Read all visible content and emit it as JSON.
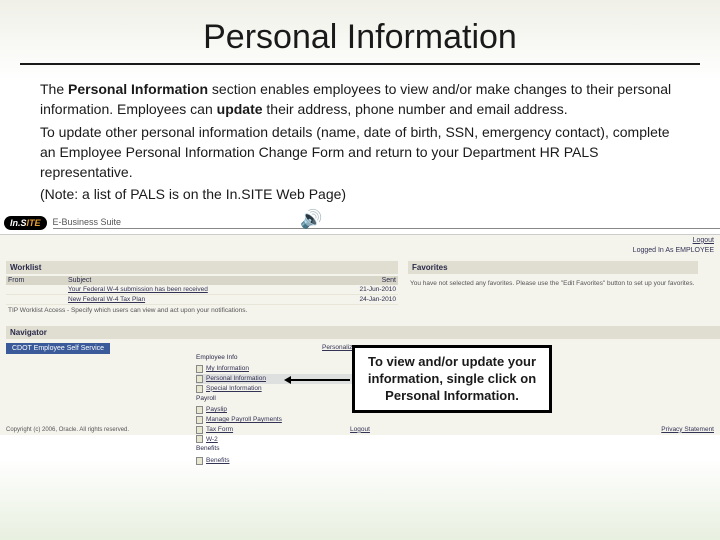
{
  "title": "Personal Information",
  "body": {
    "p1_pre": "The ",
    "p1_bold": "Personal Information",
    "p1_mid": " section enables employees to view and/or make changes to their personal  information. Employees can ",
    "p1_bold2": "update",
    "p1_post": " their address, phone number and email address.",
    "p2": "To update other personal information details (name, date of birth, SSN, emergency contact), complete an Employee Personal Information Change Form and return to your Department HR PALS representative.",
    "p3": "(Note: a list of PALS is on the In.SITE Web Page)"
  },
  "app": {
    "logo_pre": "In.S",
    "logo_post": "ITE",
    "ebs": "E-Business Suite",
    "logout": "Logout",
    "logged_in": "Logged In As EMPLOYEE"
  },
  "worklist": {
    "header": "Worklist",
    "th_from": "From",
    "th_subject": "Subject",
    "th_sent": "Sent",
    "rows": [
      {
        "from": "",
        "subject": "Your Federal W-4 submission has been received",
        "sent": "21-Jun-2010"
      },
      {
        "from": "",
        "subject": "New Federal W-4 Tax Plan",
        "sent": "24-Jan-2010"
      }
    ],
    "tip": "TIP Worklist Access - Specify which users can view and act upon your notifications."
  },
  "favorites": {
    "header": "Favorites",
    "text": "You have not selected any favorites. Please use the \"Edit Favorites\" button to set up your favorites."
  },
  "navigator": {
    "header": "Navigator",
    "tab": "CDOT Employee Self Service",
    "personalize": "Personalize",
    "groups": {
      "info": {
        "title": "Employee Info",
        "items": [
          "My Information",
          "Personal Information",
          "Special Information"
        ]
      },
      "payroll": {
        "title": "Payroll",
        "items": [
          "Payslip",
          "Manage Payroll Payments",
          "Tax Form",
          "W-2"
        ]
      },
      "benefits": {
        "title": "Benefits",
        "items": [
          "Benefits"
        ]
      }
    }
  },
  "callout": "To view and/or update your information, single click on Personal Information.",
  "footer": {
    "copyright": "Copyright (c) 2006, Oracle. All rights reserved.",
    "center": "Logout",
    "right": "Privacy Statement"
  }
}
